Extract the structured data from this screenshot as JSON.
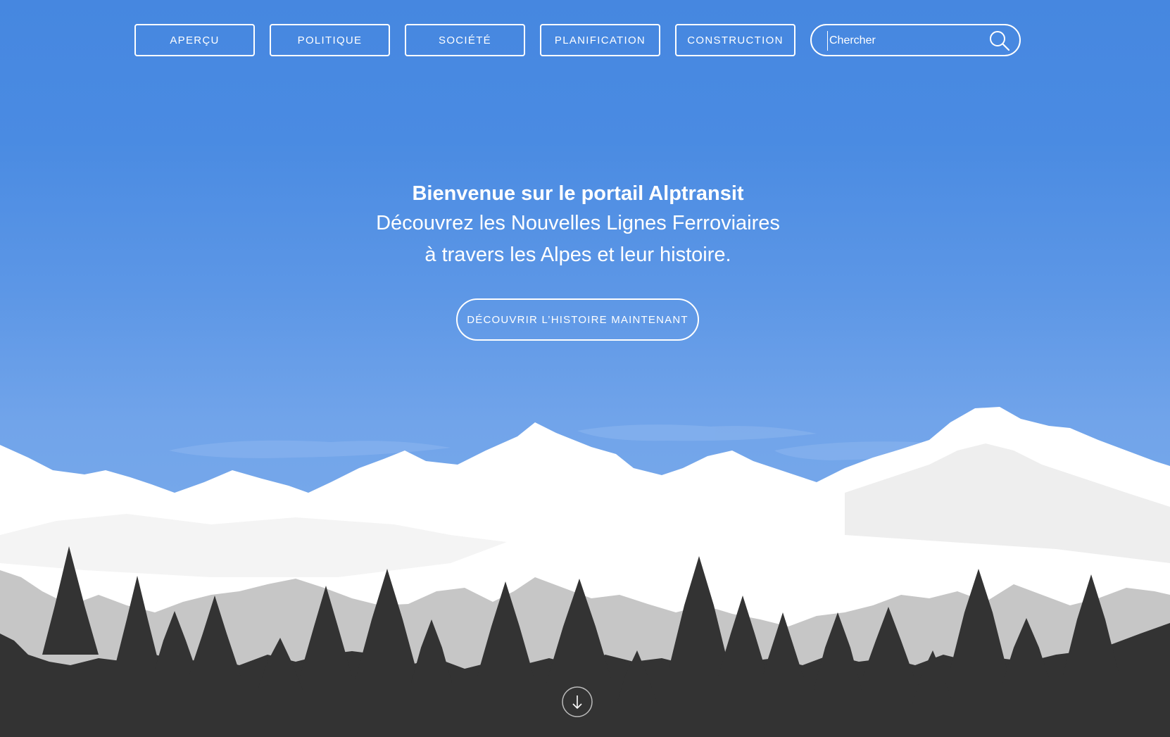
{
  "nav": {
    "items": [
      {
        "label": "APERÇU"
      },
      {
        "label": "POLITIQUE"
      },
      {
        "label": "SOCIÉTÉ"
      },
      {
        "label": "PLANIFICATION"
      },
      {
        "label": "CONSTRUCTION"
      }
    ]
  },
  "search": {
    "placeholder": "Chercher",
    "icon": "search-icon"
  },
  "hero": {
    "title": "Bienvenue sur le portail Alptransit",
    "line1": "Découvrez les Nouvelles Lignes Ferroviaires",
    "line2": "à travers les Alpes et leur histoire.",
    "cta_label": "DÉCOUVRIR L’HISTOIRE MAINTENANT"
  },
  "scroll": {
    "icon": "arrow-down-icon"
  },
  "colors": {
    "sky_top": "#4687e0",
    "sky_bottom": "#75a7ea",
    "snow": "#ffffff",
    "rock": "#c8c8c8",
    "forest": "#333333"
  }
}
